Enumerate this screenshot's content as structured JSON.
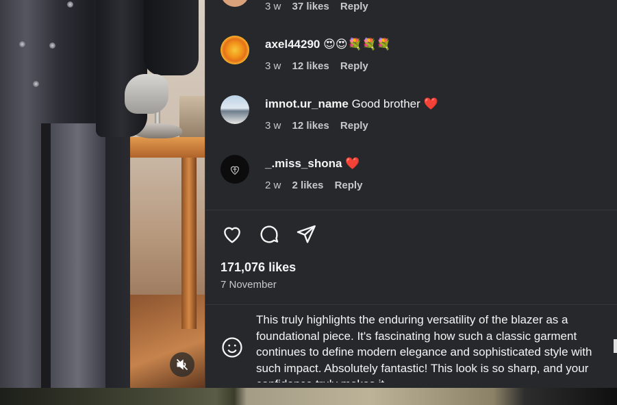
{
  "media": {
    "mute_icon": "speaker-muted-icon"
  },
  "comments": [
    {
      "username": "",
      "text": "",
      "time": "3 w",
      "likes": "37 likes",
      "reply": "Reply"
    },
    {
      "username": "axel44290",
      "text": "😍😍💐💐💐",
      "time": "3 w",
      "likes": "12 likes",
      "reply": "Reply"
    },
    {
      "username": "imnot.ur_name",
      "text": "Good brother ❤️",
      "time": "3 w",
      "likes": "12 likes",
      "reply": "Reply"
    },
    {
      "username": "_.miss_shona",
      "text": "❤️",
      "time": "2 w",
      "likes": "2 likes",
      "reply": "Reply"
    }
  ],
  "actions": {
    "like_icon": "heart-icon",
    "comment_icon": "comment-bubble-icon",
    "share_icon": "paper-plane-icon"
  },
  "post": {
    "likes": "171,076 likes",
    "date": "7 November"
  },
  "composer": {
    "emoji_icon": "smiley-icon",
    "value": "This truly highlights the enduring versatility of the blazer as a foundational piece. It's fascinating how such a classic garment continues to define modern elegance and sophisticated style with such impact. Absolutely fantastic! This look is so sharp, and your confidence truly makes it"
  },
  "colors": {
    "panel_bg": "#26282c",
    "text": "#f5f5f5",
    "muted": "#c9c9cc",
    "heart": "#e0245e"
  }
}
